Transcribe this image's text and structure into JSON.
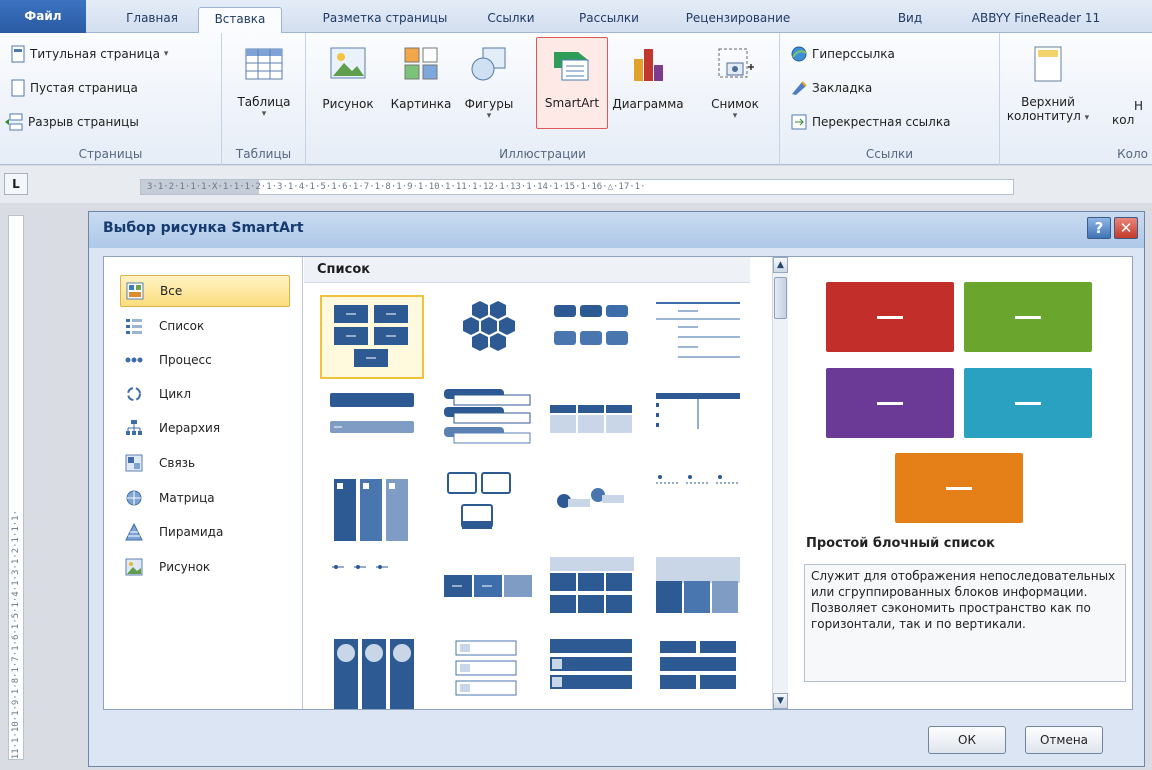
{
  "ribbon_tabs": {
    "file": "Файл",
    "home": "Главная",
    "insert": "Вставка",
    "page_layout": "Разметка страницы",
    "references": "Ссылки",
    "mailings": "Рассылки",
    "review": "Рецензирование",
    "view": "Вид",
    "abbyy": "ABBYY FineReader 11"
  },
  "ribbon": {
    "pages": {
      "cover_page": "Титульная страница",
      "blank_page": "Пустая страница",
      "page_break": "Разрыв страницы",
      "label": "Страницы"
    },
    "tables": {
      "table": "Таблица",
      "label": "Таблицы"
    },
    "illustrations": {
      "picture": "Рисунок",
      "clip_art": "Картинка",
      "shapes": "Фигуры",
      "smartart": "SmartArt",
      "chart": "Диаграмма",
      "screenshot": "Снимок",
      "label": "Иллюстрации"
    },
    "links": {
      "hyperlink": "Гиперссылка",
      "bookmark": "Закладка",
      "cross_reference": "Перекрестная ссылка",
      "label": "Ссылки"
    },
    "header_footer": {
      "header_line1": "Верхний",
      "header_line2": "колонтитул",
      "footer_line1": "Н",
      "footer_line2": "кол",
      "label": "Коло"
    }
  },
  "ruler": {
    "horizontal": "3·1·2·1·1·1·Х·1·1·1·2·1·3·1·4·1·5·1·6·1·7·1·8·1·9·1·10·1·11·1·12·1·13·1·14·1·15·1·16·△·17·1·",
    "vertical": "11·1·10·1·9·1·8·1·7·1·6·1·5·1·4·1·3·1·2·1·1·1·",
    "corner": "L"
  },
  "dialog": {
    "title": "Выбор рисунка SmartArt",
    "help_glyph": "?",
    "close_glyph": "✕",
    "categories": [
      "Все",
      "Список",
      "Процесс",
      "Цикл",
      "Иерархия",
      "Связь",
      "Матрица",
      "Пирамида",
      "Рисунок"
    ],
    "selected_category": "Все",
    "gallery_header": "Список",
    "preview_title": "Простой блочный список",
    "preview_description": "Служит для отображения непоследовательных или сгруппированных блоков информации. Позволяет сэкономить пространство как по горизонтали, так и по вертикали.",
    "ok": "ОК",
    "cancel": "Отмена"
  },
  "colors": {
    "preview_boxes": [
      "#c22e2a",
      "#6aa52e",
      "#6b3a97",
      "#2aa1c1",
      "#e57f18"
    ],
    "thumb_blue": "#2d5a93",
    "selection_yellow": "#f2c13e"
  },
  "icons": {
    "categories": [
      "all-icon",
      "list-icon",
      "process-icon",
      "cycle-icon",
      "hierarchy-icon",
      "relationship-icon",
      "matrix-icon",
      "pyramid-icon",
      "picture-icon"
    ]
  }
}
